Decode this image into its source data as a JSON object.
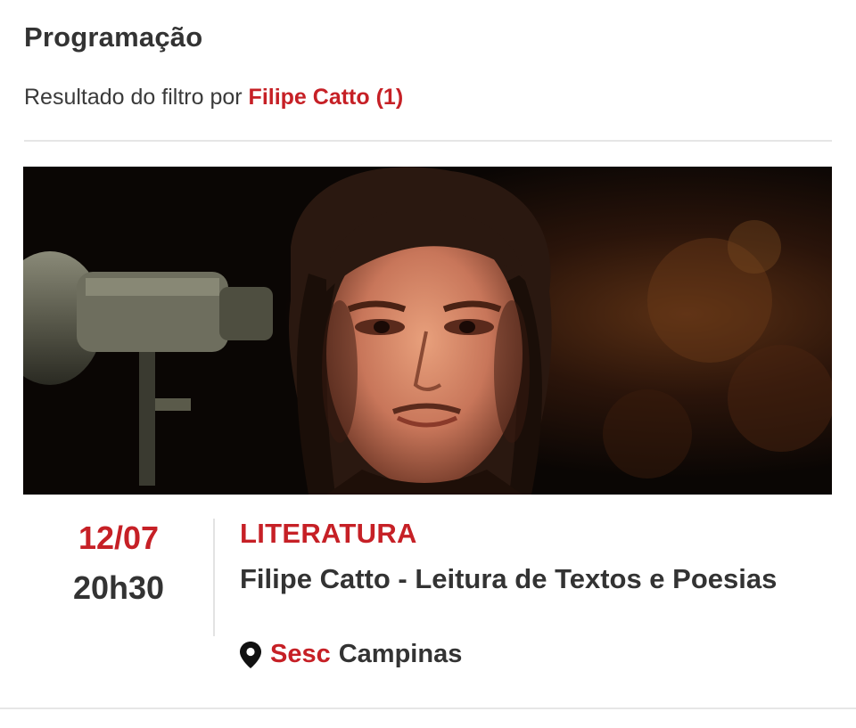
{
  "header": {
    "title": "Programação",
    "filter_prefix": "Resultado do filtro por",
    "filter_value": "Filipe Catto (1)"
  },
  "event": {
    "date": "12/07",
    "time": "20h30",
    "category": "LITERATURA",
    "title": "Filipe Catto - Leitura de Textos e Poesias",
    "location_brand": "Sesc",
    "location_name": "Campinas",
    "location_icon": "map-pin-icon"
  },
  "colors": {
    "accent": "#c62026",
    "text": "#333333",
    "divider": "#e6e6e6"
  }
}
